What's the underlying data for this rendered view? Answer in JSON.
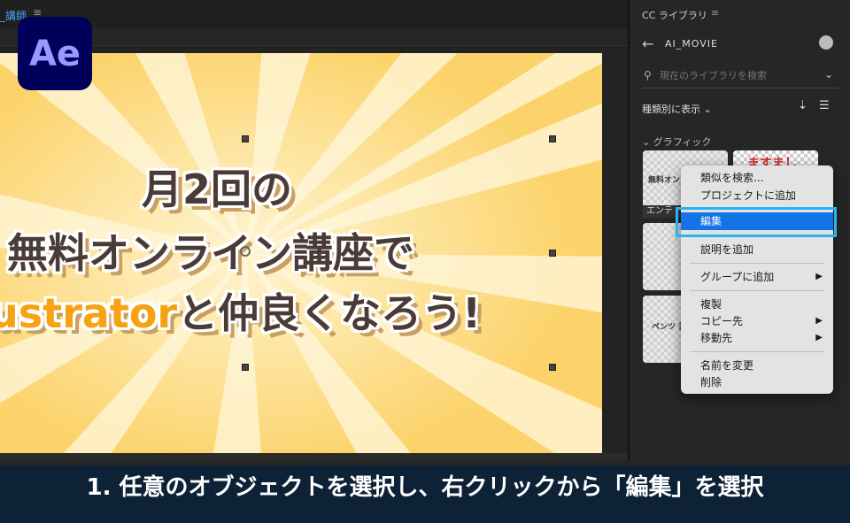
{
  "app": {
    "logo": "Ae"
  },
  "composition": {
    "tab_title": "_講師",
    "menu_glyph": "≡",
    "title_line1": "月2回の",
    "title_line2": "無料オンライン講座で",
    "title_line3_orange": "ustrator",
    "title_line3_rest": "と仲良くなろう!"
  },
  "library": {
    "panel_title": "CC ライブラリ",
    "panel_menu": "≡",
    "back_glyph": "←",
    "library_name": "AI_MOVIE",
    "search_placeholder": "現在のライブラリを検索",
    "search_icon": "search-icon",
    "view_select": "種類別に表示 ⌄",
    "section_title": "⌄ グラフィック",
    "thumbs": [
      {
        "caption": "エンテ",
        "text": "無料オンラ"
      },
      {
        "caption": "",
        "text": "ますまし"
      },
      {
        "caption": "",
        "text": ""
      },
      {
        "caption": "",
        "text": "ペンツ 苦"
      }
    ]
  },
  "context_menu": {
    "items": [
      {
        "label": "類似を検索..."
      },
      {
        "label": "プロジェクトに追加"
      },
      {
        "label": "編集"
      },
      {
        "label": "説明を追加"
      },
      {
        "label": "グループに追加",
        "submenu": "▶"
      },
      {
        "label": "複製"
      },
      {
        "label": "コピー先",
        "submenu": "▶"
      },
      {
        "label": "移動先",
        "submenu": "▶"
      },
      {
        "label": "名前を変更"
      },
      {
        "label": "削除"
      }
    ],
    "highlight_color": "#2bb3ef",
    "selected_color": "#1473e6"
  },
  "caption": "1. 任意のオブジェクトを選択し、右クリックから「編集」を選択"
}
